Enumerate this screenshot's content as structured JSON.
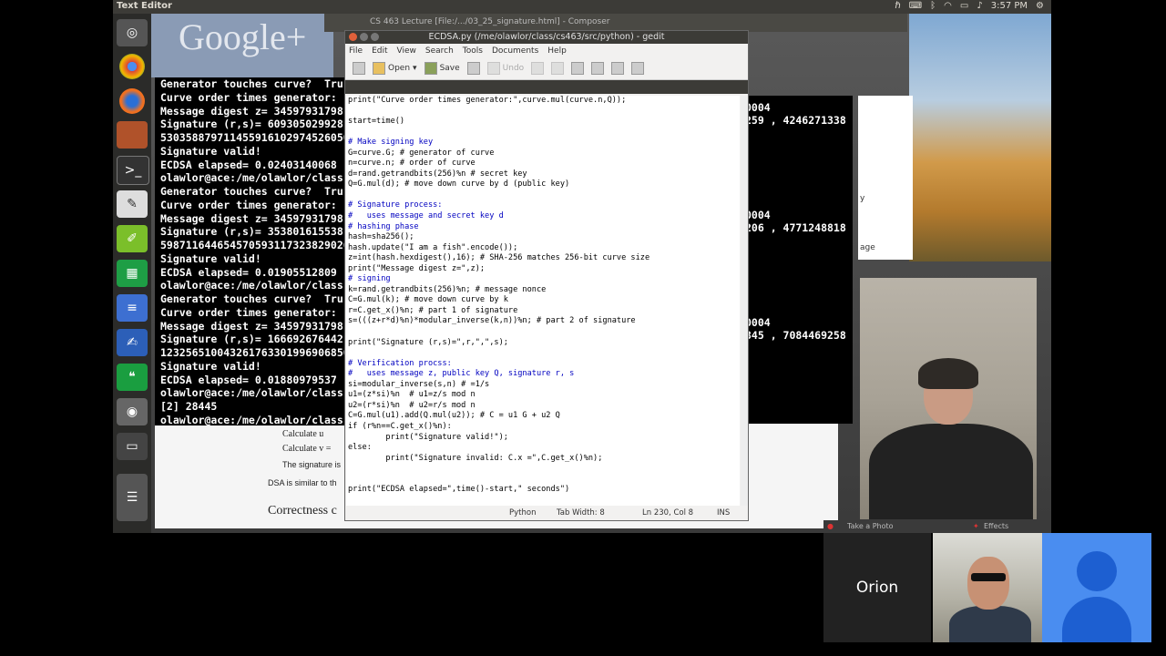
{
  "topbar": {
    "title": "Text Editor",
    "time": "3:57 PM",
    "tray_icons": [
      "hp-icon",
      "keyboard-icon",
      "bluetooth-icon",
      "wifi-icon",
      "battery-icon",
      "volume-icon"
    ]
  },
  "composer_title": "CS 463 Lecture [File:/.../03_25_signature.html] - Composer",
  "google_logo": "Google+",
  "launcher_icons": [
    "chrome-icon",
    "firefox-icon",
    "app-icon",
    "terminal-icon",
    "text-editor-icon",
    "edit-icon",
    "spreadsheet-icon",
    "document-icon",
    "writer-icon",
    "hangouts-icon",
    "screenshot-icon",
    "disk-icon",
    "stack-icon"
  ],
  "terminal": {
    "header": "Text Editor",
    "lines": [
      "Generator touches curve?  Tru",
      "Curve order times generator:",
      "Message digest z= 34597931798",
      "Signature (r,s)= 609305029928",
      "530358879711455916102974526050",
      "Signature valid!",
      "ECDSA elapsed= 0.02403140068",
      "olawlor@ace:/me/olawlor/class",
      "Generator touches curve?  Tru",
      "Curve order times generator:",
      "Message digest z= 34597931798",
      "Signature (r,s)= 353801615538",
      "598711644654570593117323829026",
      "Signature valid!",
      "ECDSA elapsed= 0.01905512809",
      "olawlor@ace:/me/olawlor/class",
      "Generator touches curve?  Tru",
      "Curve order times generator:",
      "Message digest z= 34597931798",
      "Signature (r,s)= 166692676442",
      "123256510043261763301996906850",
      "Signature valid!",
      "ECDSA elapsed= 0.01880979537",
      "olawlor@ace:/me/olawlor/class",
      "[2] 28445",
      "olawlor@ace:/me/olawlor/class"
    ]
  },
  "term2": {
    "lines": [
      "0004",
      "259 , 4246271338",
      "0004",
      "206 , 4771248818",
      "0004",
      "345 , 7084469258"
    ]
  },
  "browser": {
    "bullet1": "Calculate u",
    "bullet2": "Calculate v =",
    "bullet3": "The signature is",
    "text": "DSA is similar to th",
    "heading": "Correctness c"
  },
  "gedit": {
    "title": "ECDSA.py (/me/olawlor/class/cs463/src/python) - gedit",
    "menu": [
      "File",
      "Edit",
      "View",
      "Search",
      "Tools",
      "Documents",
      "Help"
    ],
    "toolbar": {
      "open": "Open",
      "save": "Save",
      "undo": "Undo"
    },
    "code": [
      "print(\"Curve order times generator:\",curve.mul(curve.n,Q));",
      "",
      "start=time()",
      "",
      "# Make signing key",
      "G=curve.G; # generator of curve",
      "n=curve.n; # order of curve",
      "d=rand.getrandbits(256)%n # secret key",
      "Q=G.mul(d); # move down curve by d (public key)",
      "",
      "# Signature process:",
      "#   uses message and secret key d",
      "# hashing phase",
      "hash=sha256();",
      "hash.update(\"I am a fish\".encode());",
      "z=int(hash.hexdigest(),16); # SHA-256 matches 256-bit curve size",
      "print(\"Message digest z=\",z);",
      "# signing",
      "k=rand.getrandbits(256)%n; # message nonce",
      "C=G.mul(k); # move down curve by k",
      "r=C.get_x()%n; # part 1 of signature",
      "s=(((z+r*d)%n)*modular_inverse(k,n))%n; # part 2 of signature",
      "",
      "print(\"Signature (r,s)=\",r,\",\",s);",
      "",
      "# Verification procss:",
      "#   uses message z, public key Q, signature r, s",
      "si=modular_inverse(s,n) # =1/s",
      "u1=(z*si)%n  # u1=z/s mod n",
      "u2=(r*si)%n  # u2=r/s mod n",
      "C=G.mul(u1).add(Q.mul(u2)); # C = u1 G + u2 Q",
      "if (r%n==C.get_x()%n):",
      "        print(\"Signature valid!\");",
      "else:",
      "        print(\"Signature invalid: C.x =\",C.get_x()%n);",
      "",
      "",
      "print(\"ECDSA elapsed=\",time()-start,\" seconds\")"
    ],
    "status": {
      "language": "Python",
      "tab_width": "Tab Width: 8",
      "position": "Ln 230, Col 8",
      "mode": "INS"
    }
  },
  "hangouts": {
    "take_photo": "Take a Photo",
    "effects": "Effects",
    "participant_name": "Orion"
  },
  "right_panel": {
    "texts": [
      "y",
      "age"
    ]
  },
  "colors": {
    "accent_blue": "#4a8df0",
    "terminal_bg": "#000000",
    "topbar": "#3c3b37"
  }
}
